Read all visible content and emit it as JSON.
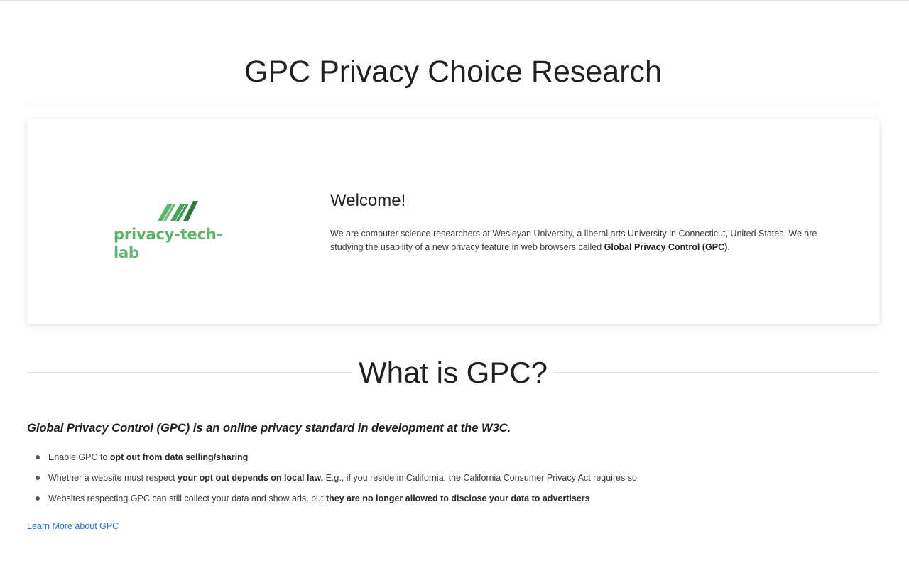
{
  "header": {
    "title": "GPC Privacy Choice Research"
  },
  "welcome": {
    "logo_text": "privacy-tech-lab",
    "heading": "Welcome!",
    "text_part1": "We are computer science researchers at Wesleyan University, a liberal arts University in Connecticut, United States. We are studying the usability of a new privacy feature in web browsers called ",
    "text_bold": "Global Privacy Control (GPC)",
    "text_part2": "."
  },
  "gpc_section": {
    "heading": "What is GPC?",
    "intro": "Global Privacy Control (GPC) is an online privacy standard in development at the W3C.",
    "bullets": [
      {
        "pre": "Enable GPC to ",
        "bold": "opt out from data selling/sharing",
        "post": ""
      },
      {
        "pre": "Whether a website must respect ",
        "bold": "your opt out depends on local law.",
        "post": " E.g., if you reside in California, the California Consumer Privacy Act requires so"
      },
      {
        "pre": "Websites respecting GPC can still collect your data and show ads, but ",
        "bold": "they are no longer allowed to disclose your data to advertisers",
        "post": ""
      }
    ],
    "learn_more_label": "Learn More about GPC"
  },
  "colors": {
    "logo_green": "#5cb46a",
    "logo_dark_green": "#2e7d3e",
    "link_blue": "#1a73e8"
  }
}
